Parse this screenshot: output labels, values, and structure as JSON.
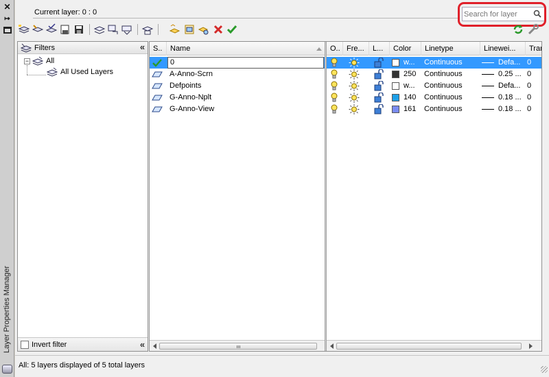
{
  "palette": {
    "title": "Layer Properties Manager",
    "close_icon": "close-icon",
    "autohide_icon": "autohide-icon",
    "properties_icon": "properties-icon"
  },
  "header": {
    "current_layer": "Current layer: 0 : 0",
    "search": {
      "placeholder": "Search for layer",
      "value": ""
    },
    "highlight_color": "#e0202a"
  },
  "toolbar": {
    "buttons": [
      "new-property-filter-icon",
      "new-group-filter-icon",
      "layer-states-manager-icon",
      "save-icon-a",
      "save-icon-b",
      "layer-walk-icon",
      "layer-translate-icon",
      "layer-isolate-icon",
      "layer-merge-icon",
      "new-layer-icon",
      "new-layer-vp-frozen-icon",
      "new-layer-frozen-icon",
      "delete-layer-icon",
      "set-current-icon"
    ],
    "right_buttons": [
      "refresh-icon",
      "settings-icon"
    ]
  },
  "filters": {
    "title": "Filters",
    "tree": [
      {
        "label": "All",
        "level": 0
      },
      {
        "label": "All Used Layers",
        "level": 1
      }
    ],
    "invert_label": "Invert filter",
    "invert_checked": false
  },
  "layers": {
    "left_columns": [
      "S..",
      "Name"
    ],
    "right_columns": [
      "O..",
      "Fre...",
      "L...",
      "Color",
      "Linetype",
      "Linewei...",
      "Tran"
    ],
    "rows": [
      {
        "status": "current",
        "name": "0",
        "color_name": "w...",
        "color_hex": "#ffffff",
        "linetype": "Continuous",
        "lineweight": "Defa...",
        "transparency": "0",
        "selected": true
      },
      {
        "status": "layer",
        "name": "A-Anno-Scrn",
        "color_name": "250",
        "color_hex": "#333333",
        "linetype": "Continuous",
        "lineweight": "0.25 ...",
        "transparency": "0",
        "selected": false
      },
      {
        "status": "layer",
        "name": "Defpoints",
        "color_name": "w...",
        "color_hex": "#ffffff",
        "linetype": "Continuous",
        "lineweight": "Defa...",
        "transparency": "0",
        "selected": false
      },
      {
        "status": "layer",
        "name": "G-Anno-Nplt",
        "color_name": "140",
        "color_hex": "#1ea0e8",
        "linetype": "Continuous",
        "lineweight": "0.18 ...",
        "transparency": "0",
        "selected": false
      },
      {
        "status": "layer",
        "name": "G-Anno-View",
        "color_name": "161",
        "color_hex": "#7a8cf2",
        "linetype": "Continuous",
        "lineweight": "0.18 ...",
        "transparency": "0",
        "selected": false
      }
    ]
  },
  "status": {
    "text": "All: 5 layers displayed of 5 total layers"
  },
  "colors": {
    "selection": "#3399ff",
    "set_current_green": "#2a9a2a",
    "delete_red": "#d42a2a"
  }
}
